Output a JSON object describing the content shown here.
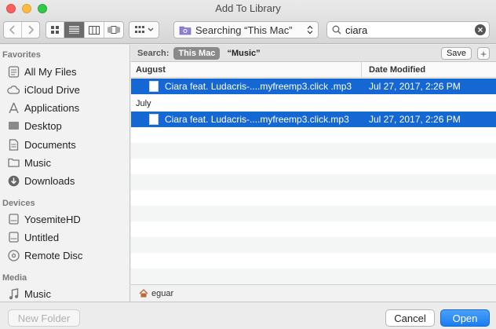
{
  "window": {
    "title": "Add To Library"
  },
  "toolbar": {
    "location_label": "Searching “This Mac”",
    "search_value": "ciara"
  },
  "sidebar": {
    "sections": [
      {
        "title": "Favorites",
        "items": [
          {
            "label": "All My Files",
            "icon": "all-files-icon"
          },
          {
            "label": "iCloud Drive",
            "icon": "cloud-icon"
          },
          {
            "label": "Applications",
            "icon": "applications-icon"
          },
          {
            "label": "Desktop",
            "icon": "desktop-icon"
          },
          {
            "label": "Documents",
            "icon": "documents-icon"
          },
          {
            "label": "Music",
            "icon": "folder-icon"
          },
          {
            "label": "Downloads",
            "icon": "downloads-icon"
          }
        ]
      },
      {
        "title": "Devices",
        "items": [
          {
            "label": "YosemiteHD",
            "icon": "hard-disk-icon"
          },
          {
            "label": "Untitled",
            "icon": "hard-disk-icon"
          },
          {
            "label": "Remote Disc",
            "icon": "disc-icon"
          }
        ]
      },
      {
        "title": "Media",
        "items": [
          {
            "label": "Music",
            "icon": "music-note-icon"
          }
        ]
      }
    ]
  },
  "scope": {
    "label": "Search:",
    "this_mac": "This Mac",
    "music": "“Music”",
    "save": "Save",
    "add": "+"
  },
  "columns": {
    "name": "August",
    "date": "Date Modified"
  },
  "groups": [
    {
      "title": "August",
      "files": [
        {
          "name": "Ciara feat. Ludacris-....myfreemp3.click .mp3",
          "date": "Jul 27, 2017, 2:26 PM"
        }
      ]
    },
    {
      "title": "July",
      "files": [
        {
          "name": "Ciara feat. Ludacris-....myfreemp3.click.mp3",
          "date": "Jul 27, 2017, 2:26 PM"
        }
      ]
    }
  ],
  "pathbar": {
    "label": "eguar"
  },
  "footer": {
    "new_folder": "New Folder",
    "cancel": "Cancel",
    "open": "Open"
  },
  "colors": {
    "selection": "#1567d3",
    "accent": "#1a7ef0"
  }
}
